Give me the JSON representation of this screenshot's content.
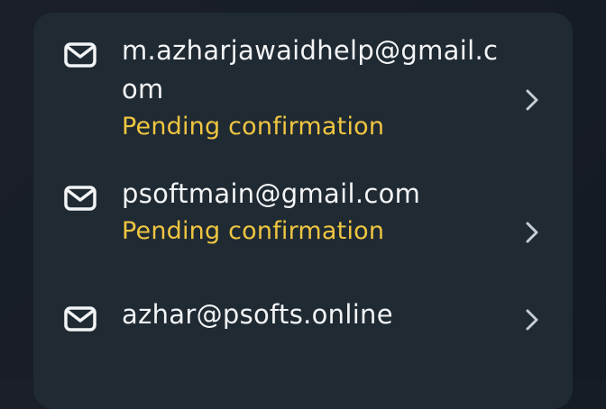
{
  "email_list": {
    "items": [
      {
        "icon": "mail-icon",
        "email": "m.azharjawaidhelp@gmail.com",
        "status": "Pending confirmation",
        "chevron": "chevron-right-icon"
      },
      {
        "icon": "mail-icon",
        "email": "psoftmain@gmail.com",
        "status": "Pending confirmation",
        "chevron": "chevron-right-icon"
      },
      {
        "icon": "mail-icon",
        "email": "azhar@psofts.online",
        "status": "",
        "chevron": "chevron-right-icon"
      }
    ]
  },
  "colors": {
    "background": "#151b23",
    "card": "#1f2a33",
    "primary_text": "#f3f4f5",
    "pending_text": "#f0c541",
    "icon": "#f3f4f5",
    "chevron": "#c7cdd2"
  }
}
